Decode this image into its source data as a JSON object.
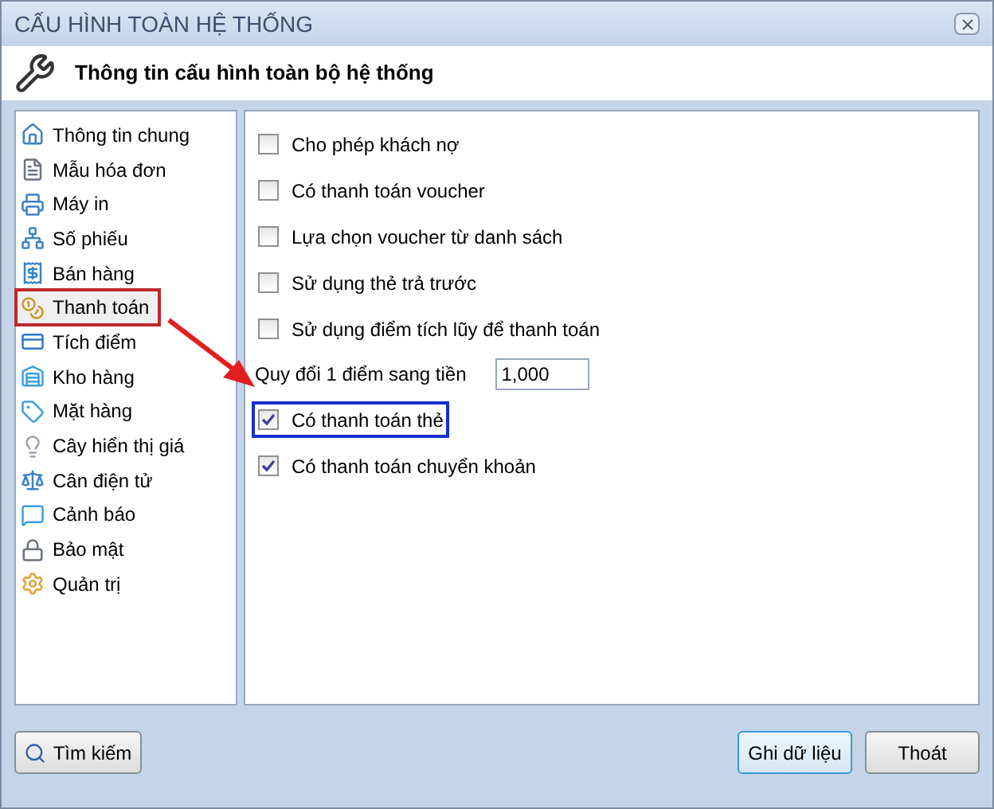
{
  "window": {
    "title": "CẤU HÌNH TOÀN HỆ THỐNG"
  },
  "header": {
    "title": "Thông tin cấu hình toàn bộ hệ thống"
  },
  "sidebar": {
    "items": [
      {
        "label": "Thông tin chung",
        "selected": false,
        "annotated": false
      },
      {
        "label": "Mẫu hóa đơn",
        "selected": false,
        "annotated": false
      },
      {
        "label": "Máy in",
        "selected": false,
        "annotated": false
      },
      {
        "label": "Số phiếu",
        "selected": false,
        "annotated": false
      },
      {
        "label": "Bán hàng",
        "selected": false,
        "annotated": false
      },
      {
        "label": "Thanh toán",
        "selected": true,
        "annotated": true
      },
      {
        "label": "Tích điểm",
        "selected": false,
        "annotated": false
      },
      {
        "label": "Kho hàng",
        "selected": false,
        "annotated": false
      },
      {
        "label": "Mặt hàng",
        "selected": false,
        "annotated": false
      },
      {
        "label": "Cây hiển thị giá",
        "selected": false,
        "annotated": false
      },
      {
        "label": "Cân điện tử",
        "selected": false,
        "annotated": false
      },
      {
        "label": "Cảnh báo",
        "selected": false,
        "annotated": false
      },
      {
        "label": "Bảo mật",
        "selected": false,
        "annotated": false
      },
      {
        "label": "Quản trị",
        "selected": false,
        "annotated": false
      }
    ]
  },
  "settings": [
    {
      "kind": "checkbox",
      "label": "Cho phép khách nợ",
      "checked": false,
      "annotated": false
    },
    {
      "kind": "checkbox",
      "label": "Có thanh toán voucher",
      "checked": false,
      "annotated": false
    },
    {
      "kind": "checkbox",
      "label": "Lựa chọn voucher từ danh sách",
      "checked": false,
      "annotated": false
    },
    {
      "kind": "checkbox",
      "label": "Sử dụng thẻ trả trước",
      "checked": false,
      "annotated": false
    },
    {
      "kind": "checkbox",
      "label": "Sử dụng điểm tích lũy để thanh toán",
      "checked": false,
      "annotated": false
    },
    {
      "kind": "number",
      "label": "Quy đổi 1 điểm sang tiền",
      "value": "1,000"
    },
    {
      "kind": "checkbox",
      "label": "Có thanh toán thẻ",
      "checked": true,
      "annotated": true
    },
    {
      "kind": "checkbox",
      "label": "Có thanh toán chuyển khoản",
      "checked": true,
      "annotated": false
    }
  ],
  "buttons": {
    "search": "Tìm kiếm",
    "save": "Ghi dữ liệu",
    "exit": "Thoát"
  }
}
